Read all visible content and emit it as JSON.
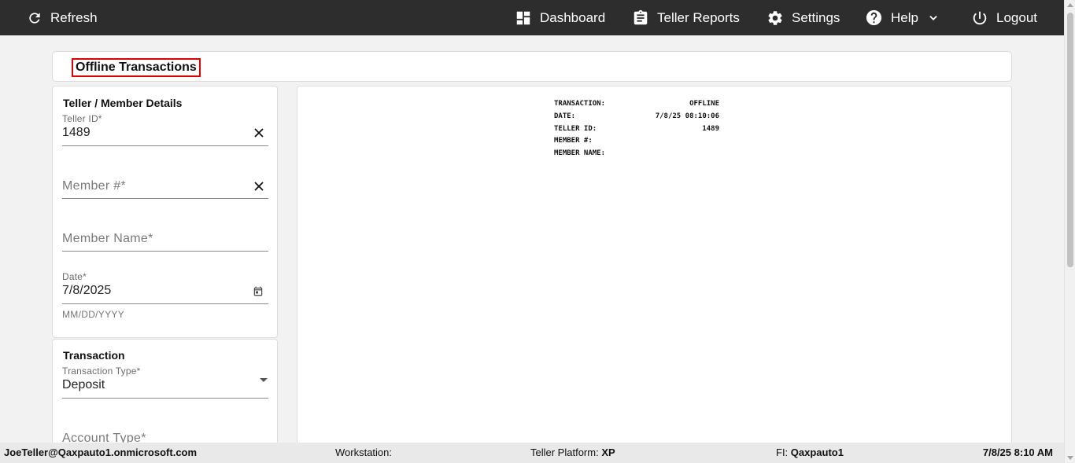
{
  "topbar": {
    "refresh": {
      "label": "Refresh",
      "icon": "refresh-icon"
    },
    "dashboard": {
      "label": "Dashboard",
      "icon": "dashboard-icon"
    },
    "teller_reports": {
      "label": "Teller Reports",
      "icon": "clipboard-icon"
    },
    "settings": {
      "label": "Settings",
      "icon": "gear-icon"
    },
    "help": {
      "label": "Help",
      "icon": "help-icon"
    },
    "logout": {
      "label": "Logout",
      "icon": "power-icon"
    }
  },
  "page": {
    "title": "Offline Transactions"
  },
  "details": {
    "heading": "Teller / Member Details",
    "teller_id": {
      "label": "Teller ID*",
      "value": "1489"
    },
    "member_number": {
      "placeholder": "Member #*"
    },
    "member_name": {
      "placeholder": "Member Name*"
    },
    "date": {
      "label": "Date*",
      "value": "7/8/2025",
      "hint": "MM/DD/YYYY"
    }
  },
  "transaction": {
    "heading": "Transaction",
    "type": {
      "label": "Transaction Type*",
      "value": "Deposit"
    },
    "account_type": {
      "placeholder": "Account Type*"
    }
  },
  "receipt": {
    "rows": [
      {
        "label": "TRANSACTION:",
        "value": "OFFLINE"
      },
      {
        "label": "DATE:",
        "value": "7/8/25 08:10:06"
      },
      {
        "label": "TELLER ID:",
        "value": "1489"
      },
      {
        "label": "MEMBER #:",
        "value": ""
      },
      {
        "label": "MEMBER NAME:",
        "value": ""
      }
    ]
  },
  "statusbar": {
    "user": "JoeTeller@Qaxpauto1.onmicrosoft.com",
    "workstation_label": "Workstation:",
    "workstation_value": "",
    "platform_label": "Teller Platform:",
    "platform_value": "XP",
    "fi_label": "FI:",
    "fi_value": "Qaxpauto1",
    "datetime": "7/8/25 8:10 AM"
  },
  "colors": {
    "topbar": "#2d2d2d",
    "highlight": "#dd0000",
    "background": "#f2f2f2"
  }
}
